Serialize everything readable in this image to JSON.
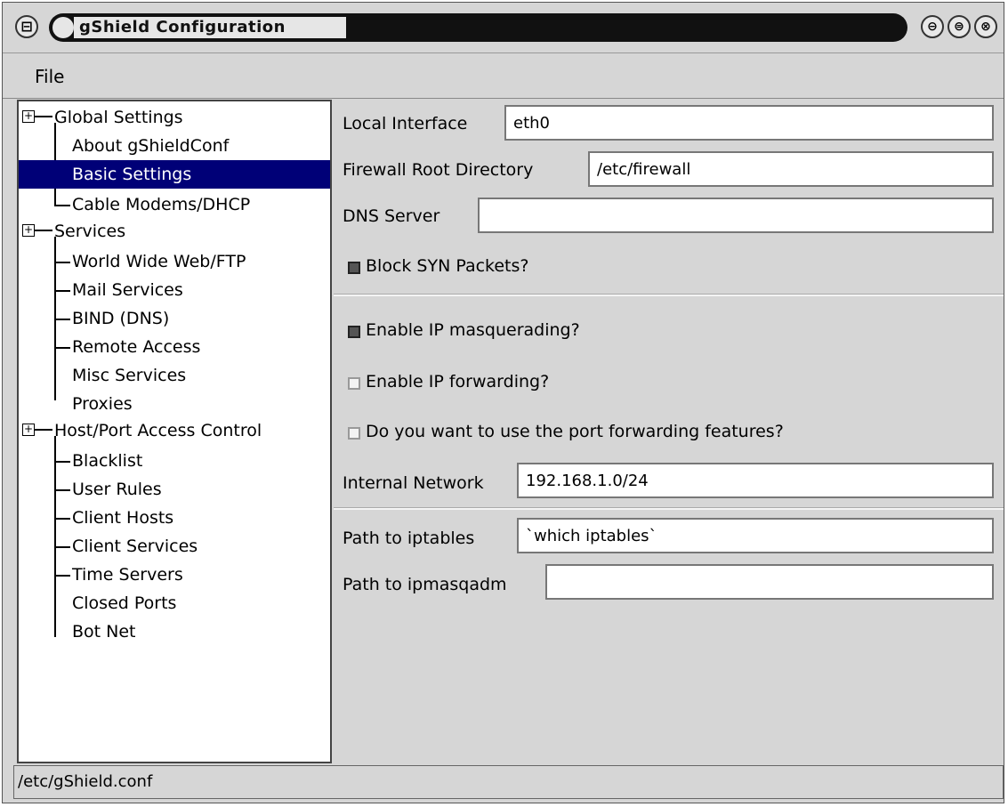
{
  "window": {
    "title": "gShield Configuration",
    "menu_button_glyph": "⊟",
    "minimize_glyph": "⊖",
    "maximize_glyph": "⊜",
    "close_glyph": "⊗"
  },
  "menubar": {
    "file_label": "File"
  },
  "tree": {
    "items": [
      {
        "label": "Global Settings",
        "expander": "+"
      },
      {
        "label": "About gShieldConf"
      },
      {
        "label": "Basic Settings",
        "selected": true
      },
      {
        "label": "Cable Modems/DHCP"
      },
      {
        "label": "Services",
        "expander": "+"
      },
      {
        "label": "World Wide Web/FTP"
      },
      {
        "label": "Mail Services"
      },
      {
        "label": "BIND (DNS)"
      },
      {
        "label": "Remote Access"
      },
      {
        "label": "Misc Services"
      },
      {
        "label": "Proxies"
      },
      {
        "label": "Host/Port Access Control",
        "expander": "+"
      },
      {
        "label": "Blacklist"
      },
      {
        "label": "User Rules"
      },
      {
        "label": "Client Hosts"
      },
      {
        "label": "Client Services"
      },
      {
        "label": "Time Servers"
      },
      {
        "label": "Closed Ports"
      },
      {
        "label": "Bot Net"
      }
    ]
  },
  "form": {
    "local_interface_label": "Local Interface",
    "local_interface_value": "eth0",
    "firewall_root_label": "Firewall Root Directory",
    "firewall_root_value": "/etc/firewall",
    "dns_server_label": "DNS Server",
    "dns_server_value": "",
    "block_syn_label": "Block SYN Packets?",
    "block_syn_checked": true,
    "ip_masq_label": "Enable IP masquerading?",
    "ip_masq_checked": true,
    "ip_forward_label": "Enable IP forwarding?",
    "ip_forward_checked": false,
    "port_forward_label": "Do you want to use the port forwarding features?",
    "port_forward_checked": false,
    "internal_network_label": "Internal Network",
    "internal_network_value": "192.168.1.0/24",
    "iptables_path_label": "Path to iptables",
    "iptables_path_value": "`which iptables`",
    "ipmasqadm_path_label": "Path to ipmasqadm",
    "ipmasqadm_path_value": ""
  },
  "statusbar": {
    "text": "/etc/gShield.conf"
  },
  "colors": {
    "selection": "#000077",
    "window_bg": "#d6d6d6"
  }
}
